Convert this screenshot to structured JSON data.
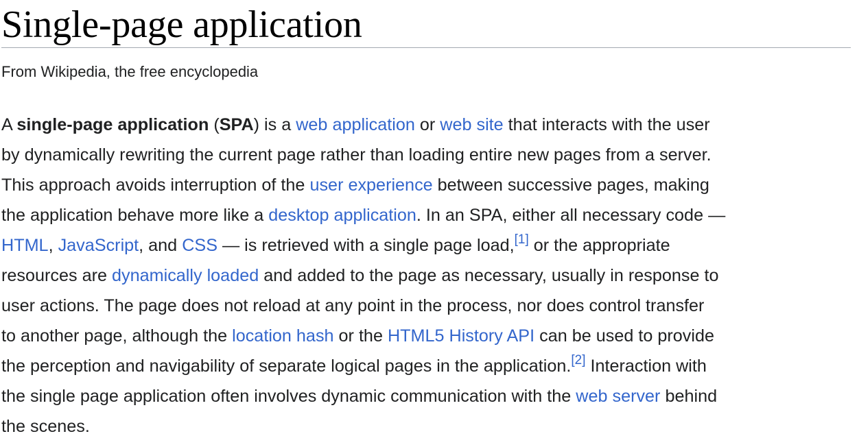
{
  "article": {
    "title": "Single-page application",
    "tagline": "From Wikipedia, the free encyclopedia"
  },
  "paragraph": {
    "l1_a": "A ",
    "l1_b": "single-page application",
    "l1_c": " (",
    "l1_d": "SPA",
    "l1_e": ") is a ",
    "l1_link1": "web application",
    "l1_f": " or ",
    "l1_link2": "web site",
    "l1_g": " that interacts with the user",
    "l2": "by dynamically rewriting the current page rather than loading entire new pages from a server.",
    "l3_a": "This approach avoids interruption of the ",
    "l3_link": "user experience",
    "l3_b": " between successive pages, making",
    "l4_a": "the application behave more like a ",
    "l4_link": "desktop application",
    "l4_b": ". In an SPA, either all necessary code —",
    "l5_link1": "HTML",
    "l5_a": ", ",
    "l5_link2": "JavaScript",
    "l5_b": ", and ",
    "l5_link3": "CSS",
    "l5_c": " — is retrieved with a single page load,",
    "l5_ref": "[1]",
    "l5_d": " or the appropriate",
    "l6_a": "resources are ",
    "l6_link": "dynamically loaded",
    "l6_b": " and added to the page as necessary, usually in response to",
    "l7": "user actions. The page does not reload at any point in the process, nor does control transfer",
    "l8_a": "to another page, although the ",
    "l8_link1": "location hash",
    "l8_b": " or the ",
    "l8_link2": "HTML5 History API",
    "l8_c": " can be used to provide",
    "l9_a": "the perception and navigability of separate logical pages in the application.",
    "l9_ref": "[2]",
    "l9_b": " Interaction with",
    "l10_a": "the single page application often involves dynamic communication with the ",
    "l10_link": "web server",
    "l10_b": " behind",
    "l11": "the scenes."
  },
  "colors": {
    "link": "#3366cc",
    "text": "#202122",
    "rule": "#a2a9b1"
  }
}
